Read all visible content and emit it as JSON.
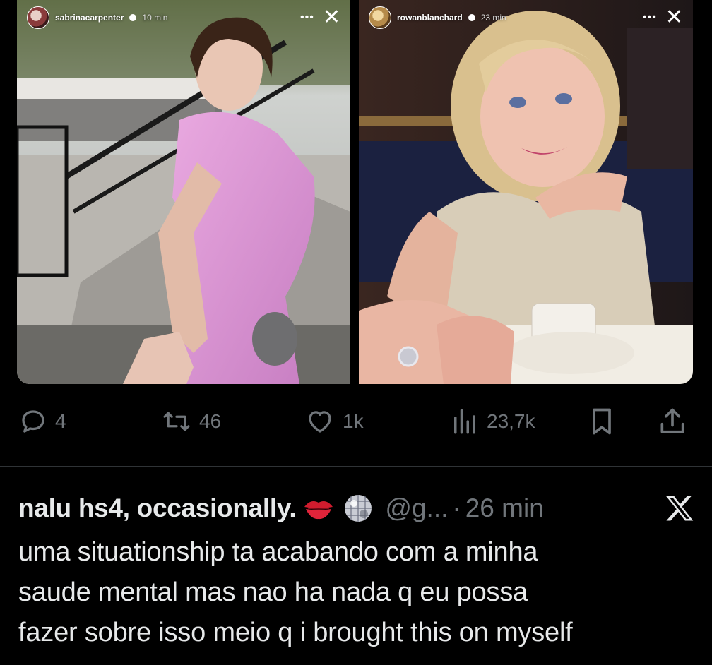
{
  "stories": [
    {
      "username": "sabrinacarpenter",
      "time": "10 min"
    },
    {
      "username": "rowanblanchard",
      "time": "23 min"
    }
  ],
  "engagement": {
    "replies": "4",
    "retweets": "46",
    "likes": "1k",
    "views": "23,7k"
  },
  "tweet": {
    "display_name": "nalu hs4, occasionally.",
    "handle": "@g...",
    "separator": "·",
    "time": "26 min",
    "text": "uma situationship ta acabando com a minha\nsaude mental mas nao ha nada q eu possa\nfazer sobre isso meio q i brought this on myself"
  },
  "icons": {
    "reply": "reply-icon",
    "retweet": "retweet-icon",
    "like": "heart-icon",
    "views": "views-icon",
    "bookmark": "bookmark-icon",
    "share": "share-icon",
    "x_logo": "x-logo-icon",
    "emoji_1": "kiss-mark-emoji",
    "emoji_2": "disco-ball-emoji"
  },
  "colors": {
    "background": "#000000",
    "text": "#e7e9ea",
    "muted": "#71767b",
    "divider": "#2f3336"
  }
}
